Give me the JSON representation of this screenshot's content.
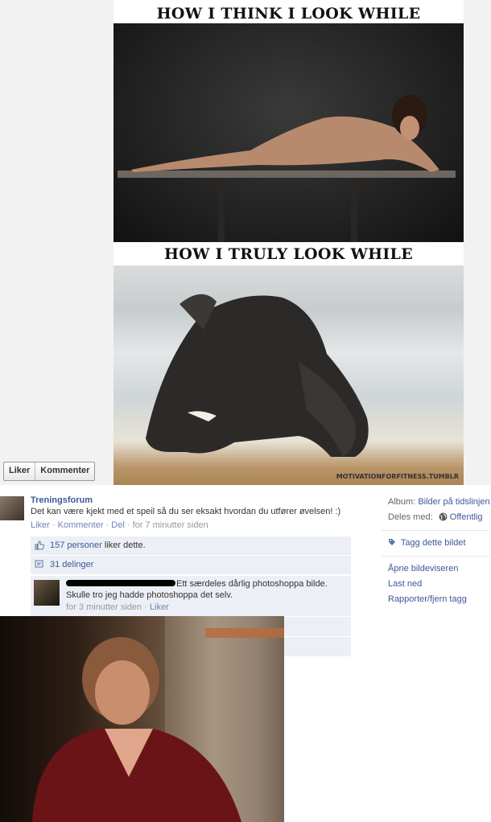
{
  "meme": {
    "caption_top": "HOW I THINK I LOOK WHILE PLANKING:",
    "caption_bottom": "HOW I TRULY LOOK WHILE PLANKING:",
    "watermark": "MOTIVATIONFORFITNESS.TUMBLR"
  },
  "photo_buttons": {
    "like": "Liker",
    "comment": "Kommenter"
  },
  "post": {
    "author": "Treningsforum",
    "caption": "Det kan være kjekt med et speil så du ser eksakt hvordan du utfører øvelsen! :)",
    "actions": {
      "like": "Liker",
      "comment": "Kommenter",
      "share": "Del",
      "time": "for 7 minutter siden"
    },
    "likes": {
      "link": "157 personer",
      "text": " liker dette."
    },
    "shares": "31 delinger",
    "comment": {
      "text": "Ett særdeles dårlig photoshoppa bilde. Skulle tro jeg hadde photoshoppa det selv.",
      "time": "for 3 minutter siden",
      "like": "Liker"
    }
  },
  "sidebar": {
    "album_label": "Album:",
    "album_value": "Bilder på tidslinjen",
    "shared_label": "Deles med:",
    "shared_value": "Offentlig",
    "tag": "Tagg dette bildet",
    "open_viewer": "Åpne bildeviseren",
    "download": "Last ned",
    "report": "Rapporter/fjern tagg"
  }
}
